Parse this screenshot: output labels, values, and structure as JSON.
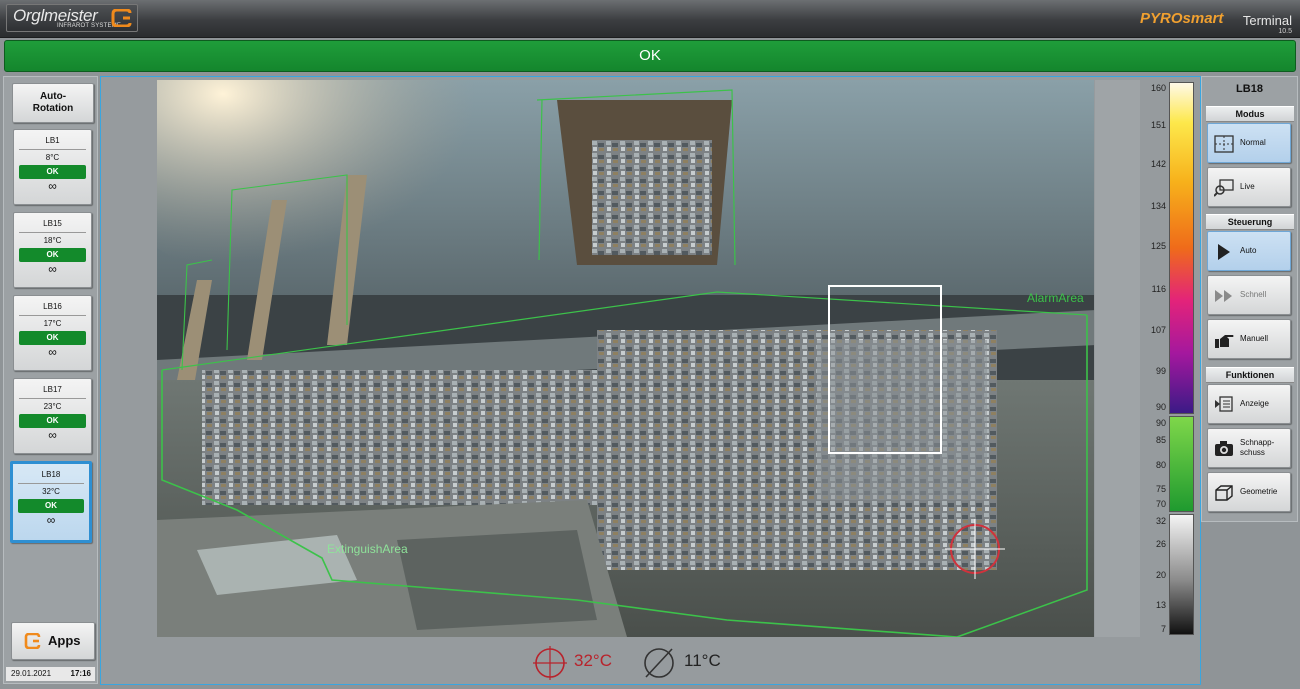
{
  "header": {
    "brand_name": "Orglmeister",
    "brand_sub": "INFRAROT SYSTEME",
    "product_name": "PYROsmart",
    "product_mode": "Terminal",
    "product_version": "10.5"
  },
  "status_text": "OK",
  "left": {
    "auto_rotation": "Auto-\nRotation",
    "sensors": [
      {
        "name": "LB1",
        "temp": "8°C",
        "status": "OK",
        "mode": "∞"
      },
      {
        "name": "LB15",
        "temp": "18°C",
        "status": "OK",
        "mode": "∞"
      },
      {
        "name": "LB16",
        "temp": "17°C",
        "status": "OK",
        "mode": "∞"
      },
      {
        "name": "LB17",
        "temp": "23°C",
        "status": "OK",
        "mode": "∞"
      },
      {
        "name": "LB18",
        "temp": "32°C",
        "status": "OK",
        "mode": "∞"
      }
    ],
    "apps_label": "Apps",
    "date": "29.01.2021",
    "time": "17:16"
  },
  "view": {
    "alarm_area_label": "AlarmArea",
    "extinguish_area_label": "ExtinguishArea",
    "spot_temp": "32°C",
    "min_temp": "11°C"
  },
  "scale": {
    "hot_ticks": [
      "160",
      "151",
      "142",
      "134",
      "125",
      "116",
      "107",
      "99",
      "90"
    ],
    "mid_ticks": [
      "90",
      "85",
      "80",
      "75",
      "70"
    ],
    "cold_ticks": [
      "32",
      "26",
      "20",
      "13",
      "7"
    ]
  },
  "right": {
    "title": "LB18",
    "modus_label": "Modus",
    "normal_label": "Normal",
    "live_label": "Live",
    "steuerung_label": "Steuerung",
    "auto_label": "Auto",
    "schnell_label": "Schnell",
    "manuell_label": "Manuell",
    "funktionen_label": "Funktionen",
    "anzeige_label": "Anzeige",
    "schnappschuss_label": "Schnapp-\nschuss",
    "geometrie_label": "Geometrie"
  },
  "colors": {
    "ok_green": "#138a2b",
    "status_bar_green": "#1f9d3a",
    "alarm_green": "#3cc24a",
    "spot_red": "#b8232c",
    "selection_blue": "#2e8fd2",
    "brand_orange": "#f0a030"
  }
}
